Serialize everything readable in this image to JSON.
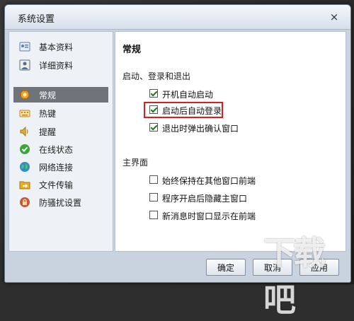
{
  "window": {
    "title": "系统设置",
    "close_glyph": "×"
  },
  "sidebar": {
    "items": [
      {
        "label": "基本资料",
        "icon": "profile-card-icon",
        "color": "#5a7fb5"
      },
      {
        "label": "详细资料",
        "icon": "detail-card-icon",
        "color": "#4a6fa0"
      },
      {
        "label": "常规",
        "icon": "gear-icon",
        "color": "#f0a020",
        "selected": true
      },
      {
        "label": "热键",
        "icon": "keyboard-icon",
        "color": "#e0a030"
      },
      {
        "label": "提醒",
        "icon": "speaker-icon",
        "color": "#e0b030"
      },
      {
        "label": "在线状态",
        "icon": "online-status-icon",
        "color": "#3aa53a"
      },
      {
        "label": "网络连接",
        "icon": "globe-icon",
        "color": "#2a8fd0"
      },
      {
        "label": "文件传输",
        "icon": "file-transfer-icon",
        "color": "#e8b020"
      },
      {
        "label": "防骚扰设置",
        "icon": "shield-lock-icon",
        "color": "#c05a3a"
      }
    ]
  },
  "content": {
    "title": "常规",
    "group1_label": "启动、登录和退出",
    "group1_options": [
      {
        "label": "开机自动启动",
        "checked": true
      },
      {
        "label": "启动后自动登录",
        "checked": true,
        "highlighted": true
      },
      {
        "label": "退出时弹出确认窗口",
        "checked": true
      }
    ],
    "group2_label": "主界面",
    "group2_options": [
      {
        "label": "始终保持在其他窗口前端",
        "checked": false
      },
      {
        "label": "程序开启后隐藏主窗口",
        "checked": false
      },
      {
        "label": "新消息时窗口显示在前端",
        "checked": false
      }
    ]
  },
  "footer": {
    "ok_label": "确定",
    "cancel_label": "取消",
    "apply_label": "应用"
  },
  "watermark": {
    "text": "下载吧"
  },
  "colors": {
    "highlight_border": "#d42020",
    "selected_bg": "#6f737a"
  }
}
